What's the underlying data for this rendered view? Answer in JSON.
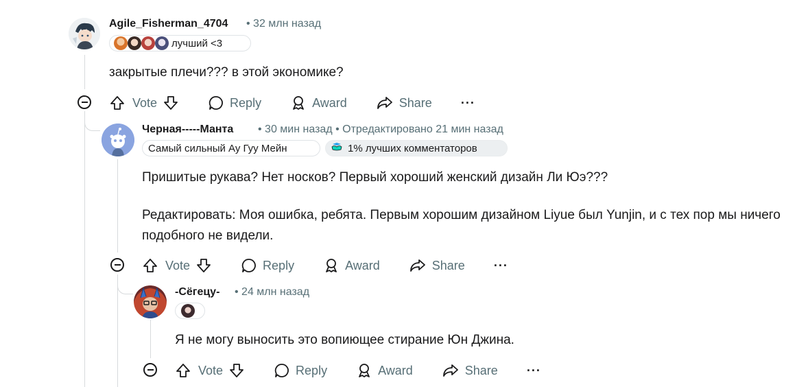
{
  "comments": [
    {
      "username": "Agile_Fisherman_4704",
      "meta": "• 32 млн назад",
      "flair": "лучший <3",
      "body": "закрытые плечи??? в этой экономике?"
    },
    {
      "username": "Черная-----Манта",
      "meta": "• 30 мин назад • Отредактировано 21 мин назад",
      "flair_1": "Самый сильный Ау Гуу Мейн",
      "flair_2": "1% лучших комментаторов",
      "body_1": "Пришитые рукава? Нет носков? Первый хороший женский дизайн Ли Юэ???",
      "body_2": "Редактировать: Моя ошибка, ребята. Первым хорошим дизайном Liyue был Yunjin, и с тех пор мы ничего подобного не видели."
    },
    {
      "username": "-Сёгецу-",
      "meta": "• 24 млн назад",
      "body": "Я не могу выносить это вопиющее стирание Юн Джина."
    }
  ],
  "actions": {
    "vote": "Vote",
    "reply": "Reply",
    "award": "Award",
    "share": "Share",
    "more": "···"
  },
  "colors": {
    "meta": "#576f76",
    "thread_line": "#d7dadc",
    "flair_bg": "#f2f4f5"
  }
}
